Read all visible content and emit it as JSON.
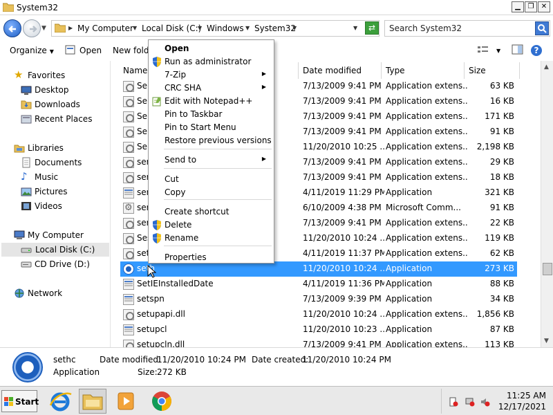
{
  "window": {
    "title": "System32"
  },
  "address": {
    "crumbs": [
      "My Computer",
      "Local Disk (C:)",
      "Windows",
      "System32"
    ],
    "search_placeholder": "Search System32"
  },
  "toolbar": {
    "organize": "Organize",
    "open": "Open",
    "new_folder": "New folde"
  },
  "nav": {
    "favorites": "Favorites",
    "desktop": "Desktop",
    "downloads": "Downloads",
    "recent_places": "Recent Places",
    "libraries": "Libraries",
    "documents": "Documents",
    "music": "Music",
    "pictures": "Pictures",
    "videos": "Videos",
    "my_computer": "My Computer",
    "local_disk": "Local Disk (C:)",
    "cd_drive": "CD Drive (D:)",
    "network": "Network"
  },
  "columns": {
    "name": "Name",
    "date_modified": "Date modified",
    "type": "Type",
    "size": "Size"
  },
  "files": [
    {
      "name": "Ser",
      "date": "7/13/2009 9:41 PM",
      "type": "Application extens...",
      "size": "63 KB",
      "icon": "dll"
    },
    {
      "name": "Ser",
      "date": "7/13/2009 9:41 PM",
      "type": "Application extens...",
      "size": "16 KB",
      "icon": "dll"
    },
    {
      "name": "Ser",
      "date": "7/13/2009 9:41 PM",
      "type": "Application extens...",
      "size": "171 KB",
      "icon": "dll"
    },
    {
      "name": "Ser",
      "date": "7/13/2009 9:41 PM",
      "type": "Application extens...",
      "size": "91 KB",
      "icon": "dll"
    },
    {
      "name": "Ser",
      "date": "11/20/2010 10:25 ...",
      "type": "Application extens...",
      "size": "2,198 KB",
      "icon": "dll"
    },
    {
      "name": "ser",
      "date": "7/13/2009 9:41 PM",
      "type": "Application extens...",
      "size": "29 KB",
      "icon": "dll"
    },
    {
      "name": "ser",
      "date": "7/13/2009 9:41 PM",
      "type": "Application extens...",
      "size": "18 KB",
      "icon": "dll"
    },
    {
      "name": "ser",
      "date": "4/11/2019 11:29 PM",
      "type": "Application",
      "size": "321 KB",
      "icon": "app"
    },
    {
      "name": "ser",
      "date": "6/10/2009 4:38 PM",
      "type": "Microsoft Comm...",
      "size": "91 KB",
      "icon": "msc"
    },
    {
      "name": "ser",
      "date": "7/13/2009 9:41 PM",
      "type": "Application extens...",
      "size": "22 KB",
      "icon": "dll"
    },
    {
      "name": "Ses",
      "date": "11/20/2010 10:24 ...",
      "type": "Application extens...",
      "size": "119 KB",
      "icon": "dll"
    },
    {
      "name": "set",
      "date": "4/11/2019 11:37 PM",
      "type": "Application extens...",
      "size": "62 KB",
      "icon": "dll"
    },
    {
      "name": "seth",
      "date": "11/20/2010 10:24 ...",
      "type": "Application",
      "size": "273 KB",
      "icon": "sethc",
      "selected": true
    },
    {
      "name": "SetIEInstalledDate",
      "date": "4/11/2019 11:36 PM",
      "type": "Application",
      "size": "88 KB",
      "icon": "app"
    },
    {
      "name": "setspn",
      "date": "7/13/2009 9:39 PM",
      "type": "Application",
      "size": "34 KB",
      "icon": "app"
    },
    {
      "name": "setupapi.dll",
      "date": "11/20/2010 10:24 ...",
      "type": "Application extens...",
      "size": "1,856 KB",
      "icon": "dll"
    },
    {
      "name": "setupcl",
      "date": "11/20/2010 10:23 ...",
      "type": "Application",
      "size": "87 KB",
      "icon": "app"
    },
    {
      "name": "setupcln.dll",
      "date": "7/13/2009 9:41 PM",
      "type": "Application extens...",
      "size": "113 KB",
      "icon": "dll"
    }
  ],
  "details": {
    "name": "sethc",
    "type": "Application",
    "date_modified_label": "Date modified:",
    "date_modified": "11/20/2010 10:24 PM",
    "date_created_label": "Date created:",
    "date_created": "11/20/2010 10:24 PM",
    "size_label": "Size:",
    "size": "272 KB"
  },
  "context_menu": [
    {
      "label": "Open",
      "bold": true
    },
    {
      "label": "Run as administrator",
      "shield": true
    },
    {
      "label": "7-Zip",
      "submenu": true
    },
    {
      "label": "CRC SHA",
      "submenu": true
    },
    {
      "label": "Edit with Notepad++",
      "notepad": true
    },
    {
      "label": "Pin to Taskbar"
    },
    {
      "label": "Pin to Start Menu"
    },
    {
      "label": "Restore previous versions"
    },
    {
      "label": "Send to",
      "submenu": true
    },
    {
      "label": "Cut"
    },
    {
      "label": "Copy"
    },
    {
      "label": "Create shortcut"
    },
    {
      "label": "Delete",
      "shield": true
    },
    {
      "label": "Rename",
      "shield": true
    },
    {
      "label": "Properties"
    }
  ],
  "taskbar": {
    "start": "Start",
    "time": "11:25 AM",
    "date": "12/17/2021"
  },
  "colors": {
    "selection": "#3399ff",
    "accent": "#1d5fbd"
  }
}
